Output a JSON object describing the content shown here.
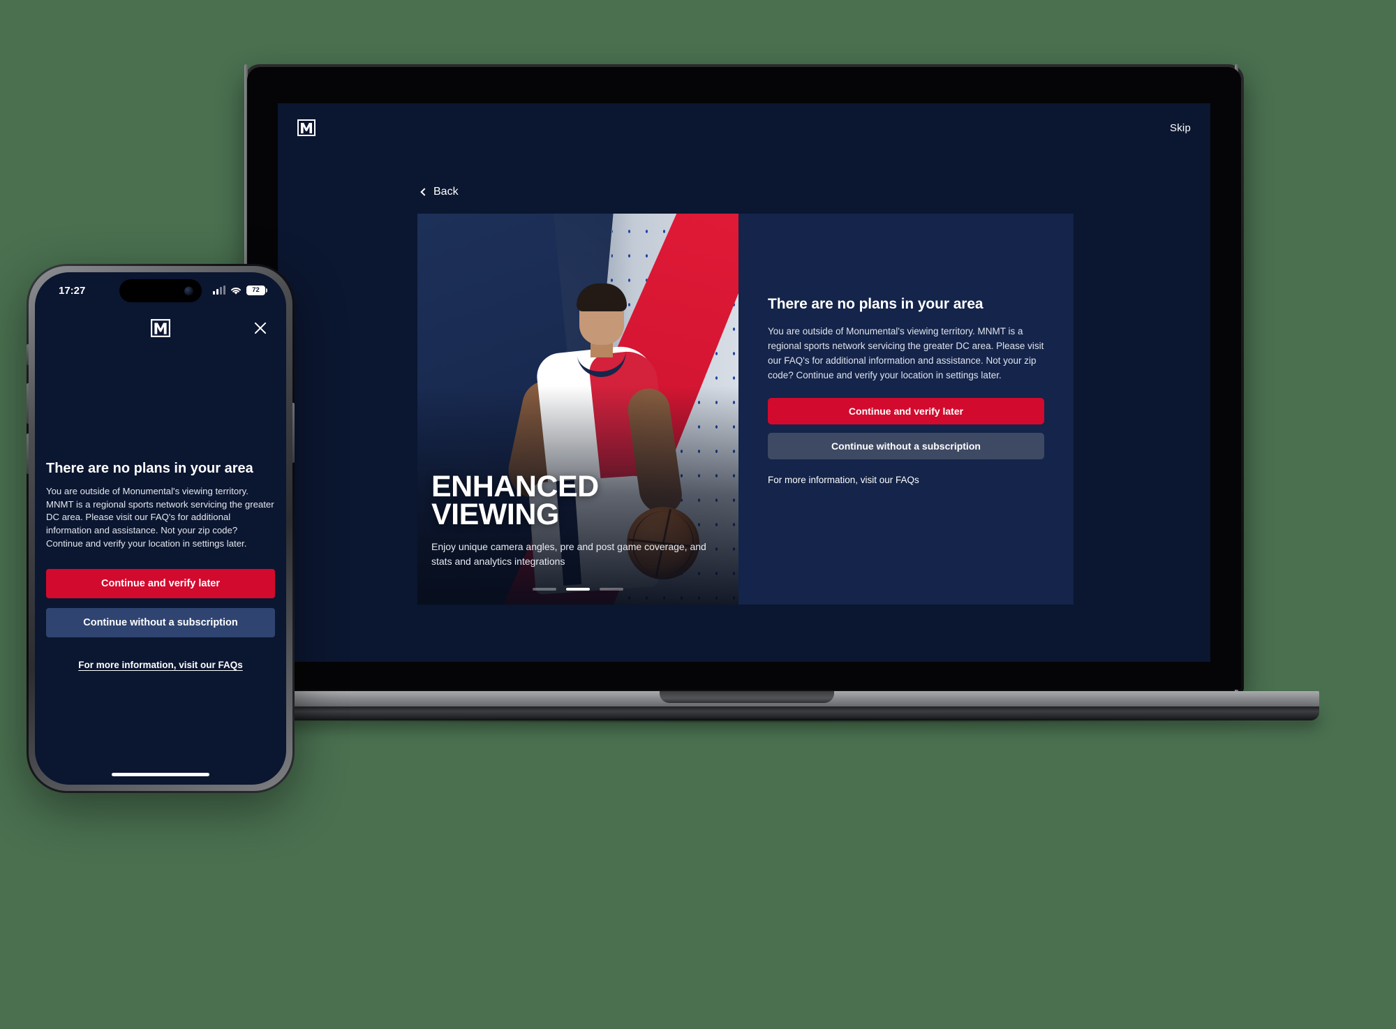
{
  "background_color": "#4a7050",
  "brand": {
    "logo_name": "monumental-m-logo",
    "accent_red": "#d20a2e",
    "navy_panel": "#14244a",
    "page_navy": "#0b1630"
  },
  "desktop": {
    "header": {
      "logo_alt": "M",
      "skip_label": "Skip"
    },
    "back_label": "Back",
    "hero": {
      "title_line1": "ENHANCED",
      "title_line2": "VIEWING",
      "subtitle": "Enjoy unique camera angles, pre and post game coverage, and stats and analytics integrations",
      "carousel": {
        "count": 3,
        "active_index": 1
      }
    },
    "panel": {
      "heading": "There are no plans in your area",
      "body": "You are outside of Monumental's viewing territory. MNMT is a regional sports network servicing the greater DC area. Please visit our FAQ's for additional information and assistance. Not your zip code? Continue and verify your location in settings later.",
      "primary_button": "Continue and verify later",
      "secondary_button": "Continue without a subscription",
      "faq_link": "For more information, visit our FAQs"
    }
  },
  "phone": {
    "status_bar": {
      "time": "17:27",
      "cellular_icon": "signal-bars-icon",
      "wifi_icon": "wifi-icon",
      "battery_level": "72"
    },
    "appbar": {
      "logo_alt": "M",
      "close_icon": "close-icon"
    },
    "content": {
      "heading": "There are no plans in your area",
      "body": "You are outside of Monumental's viewing territory. MNMT is a regional sports network servicing the greater DC area. Please visit our FAQ's for additional information and assistance. Not your zip code? Continue and verify your location in settings later.",
      "primary_button": "Continue and verify later",
      "secondary_button": "Continue without a subscription",
      "faq_link": "For more information, visit our FAQs"
    }
  }
}
